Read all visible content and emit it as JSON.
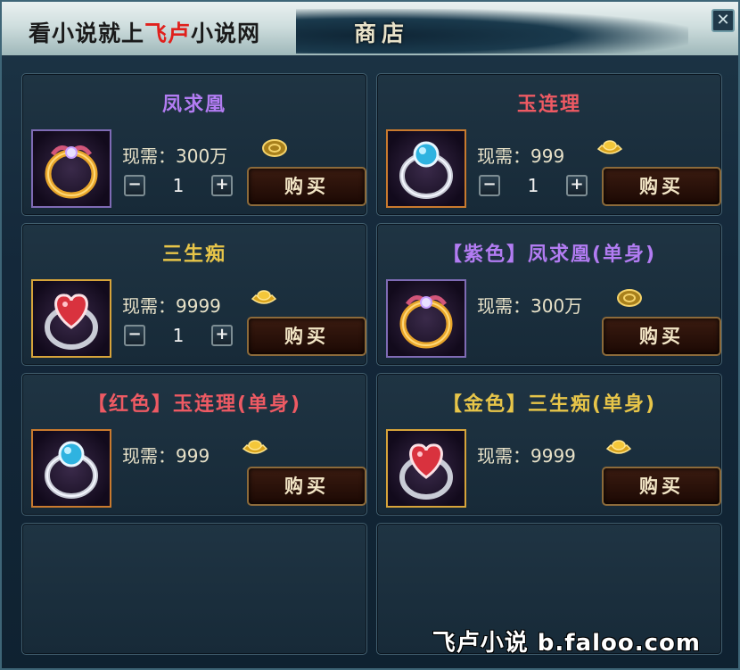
{
  "header": {
    "site_text_prefix": "看小说就上",
    "site_text_highlight": "飞卢",
    "site_text_suffix": "小说网",
    "tab_title": "商店",
    "close_icon": "close-icon"
  },
  "labels": {
    "price_prefix": "现需：",
    "buy": "购买"
  },
  "colors": {
    "purple_name": "#b27cf2",
    "red_name": "#ee5a63",
    "gold_name": "#e7c549"
  },
  "items": [
    {
      "name": "凤求凰",
      "price": "300万",
      "currency": "coin",
      "qty": "1",
      "has_qty": true,
      "ring": "gold-ring"
    },
    {
      "name": "玉连理",
      "price": "999",
      "currency": "ingot",
      "qty": "1",
      "has_qty": true,
      "ring": "blue-ring"
    },
    {
      "name": "三生痴",
      "price": "9999",
      "currency": "ingot",
      "qty": "1",
      "has_qty": true,
      "ring": "heart-ring"
    },
    {
      "name": "【紫色】凤求凰(单身)",
      "price": "300万",
      "currency": "coin",
      "has_qty": false,
      "ring": "gold-ring"
    },
    {
      "name": "【红色】玉连理(单身)",
      "price": "999",
      "currency": "ingot",
      "has_qty": false,
      "ring": "blue-ring"
    },
    {
      "name": "【金色】三生痴(单身)",
      "price": "9999",
      "currency": "ingot",
      "has_qty": false,
      "ring": "heart-ring"
    }
  ],
  "watermark": "飞卢小说  b.faloo.com"
}
